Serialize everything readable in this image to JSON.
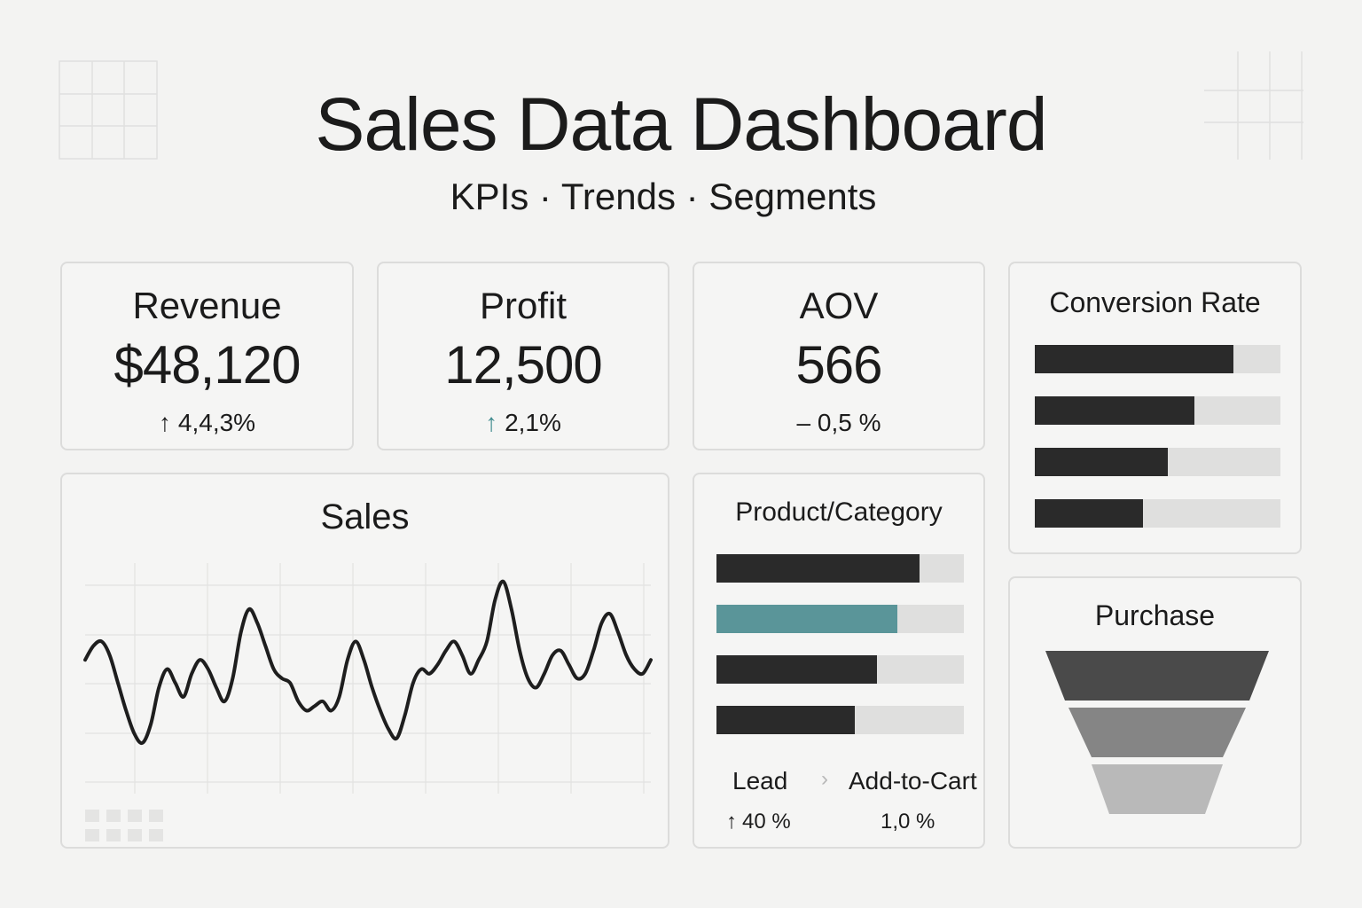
{
  "header": {
    "title": "Sales Data Dashboard",
    "subtitle": "KPIs · Trends · Segments"
  },
  "kpis": [
    {
      "label": "Revenue",
      "value": "$48,120",
      "change": "4,4,3%",
      "arrow": "↑",
      "arrow_color": "#2a2a2a"
    },
    {
      "label": "Profit",
      "value": "12,500",
      "change": "2,1%",
      "arrow": "↑",
      "arrow_color": "#3f8a8e"
    },
    {
      "label": "AOV",
      "value": "566",
      "change": "– 0,5 %",
      "arrow": "",
      "arrow_color": "#2a2a2a"
    }
  ],
  "conversion": {
    "title": "Conversion Rate",
    "bars": [
      0.81,
      0.65,
      0.54,
      0.44
    ]
  },
  "product": {
    "title": "Product/Category",
    "bars": [
      {
        "value": 0.82,
        "color": "#2a2a2a"
      },
      {
        "value": 0.73,
        "color": "#5a9599"
      },
      {
        "value": 0.65,
        "color": "#2a2a2a"
      },
      {
        "value": 0.56,
        "color": "#2a2a2a"
      }
    ],
    "funnel": {
      "from_label": "Lead",
      "separator": "›",
      "to_label": "Add-to-Cart",
      "from_arrow": "↑",
      "from_pct": "40 %",
      "to_pct": "1,0 %"
    }
  },
  "purchase": {
    "title": "Purchase",
    "stage_colors": [
      "#4a4a4a",
      "#858585",
      "#b9b9b9"
    ]
  },
  "sales": {
    "title": "Sales"
  },
  "chart_data": {
    "type": "line",
    "title": "Sales",
    "xlabel": "",
    "ylabel": "",
    "x": [
      0,
      1,
      2,
      3,
      4,
      5,
      6,
      7,
      8,
      9,
      10,
      11,
      12,
      13,
      14,
      15,
      16,
      17,
      18,
      19,
      20,
      21,
      22,
      23,
      24,
      25,
      26,
      27,
      28,
      29,
      30,
      31,
      32,
      33,
      34,
      35,
      36,
      37,
      38,
      39,
      40,
      41,
      42,
      43,
      44,
      45,
      46,
      47,
      48,
      49,
      50,
      51,
      52,
      53,
      54,
      55,
      56,
      57,
      58,
      59,
      60,
      61,
      62,
      63,
      64,
      65,
      66,
      67,
      68,
      69,
      70,
      71,
      72,
      73,
      74,
      75,
      76,
      77,
      78,
      79
    ],
    "values": [
      58,
      64,
      66,
      60,
      48,
      36,
      26,
      22,
      30,
      46,
      54,
      48,
      42,
      52,
      58,
      54,
      46,
      40,
      50,
      70,
      80,
      74,
      64,
      54,
      50,
      48,
      40,
      36,
      38,
      40,
      36,
      42,
      58,
      66,
      58,
      46,
      36,
      28,
      24,
      34,
      48,
      54,
      52,
      56,
      62,
      66,
      60,
      52,
      58,
      66,
      84,
      92,
      80,
      62,
      50,
      46,
      52,
      60,
      62,
      56,
      50,
      52,
      62,
      74,
      78,
      70,
      60,
      54,
      52,
      58
    ],
    "ylim": [
      0,
      100
    ],
    "grid": true
  }
}
